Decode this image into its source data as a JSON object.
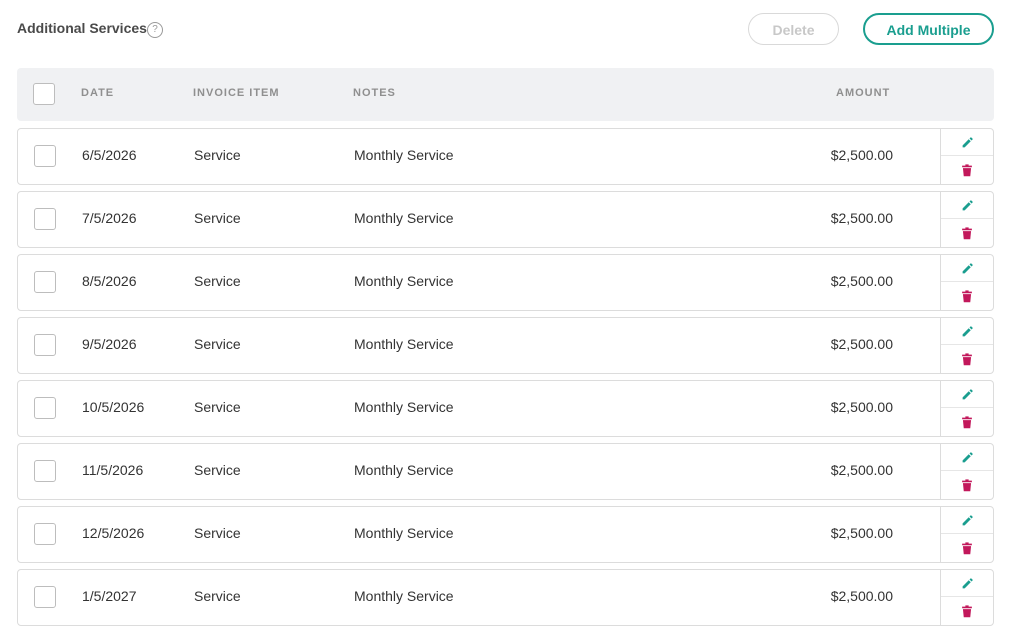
{
  "header": {
    "title": "Additional Services",
    "help_glyph": "?",
    "delete_label": "Delete",
    "add_multiple_label": "Add Multiple"
  },
  "columns": {
    "date": "DATE",
    "invoice_item": "INVOICE ITEM",
    "notes": "NOTES",
    "amount": "AMOUNT"
  },
  "rows": [
    {
      "date": "6/5/2026",
      "item": "Service",
      "notes": "Monthly Service",
      "amount": "$2,500.00"
    },
    {
      "date": "7/5/2026",
      "item": "Service",
      "notes": "Monthly Service",
      "amount": "$2,500.00"
    },
    {
      "date": "8/5/2026",
      "item": "Service",
      "notes": "Monthly Service",
      "amount": "$2,500.00"
    },
    {
      "date": "9/5/2026",
      "item": "Service",
      "notes": "Monthly Service",
      "amount": "$2,500.00"
    },
    {
      "date": "10/5/2026",
      "item": "Service",
      "notes": "Monthly Service",
      "amount": "$2,500.00"
    },
    {
      "date": "11/5/2026",
      "item": "Service",
      "notes": "Monthly Service",
      "amount": "$2,500.00"
    },
    {
      "date": "12/5/2026",
      "item": "Service",
      "notes": "Monthly Service",
      "amount": "$2,500.00"
    },
    {
      "date": "1/5/2027",
      "item": "Service",
      "notes": "Monthly Service",
      "amount": "$2,500.00"
    }
  ],
  "icons": {
    "help": "question-circle-icon",
    "edit": "pencil-icon",
    "delete": "trash-icon"
  },
  "colors": {
    "accent": "#1a9e8f",
    "danger": "#c2185b",
    "header_bg": "#f0f1f3"
  }
}
